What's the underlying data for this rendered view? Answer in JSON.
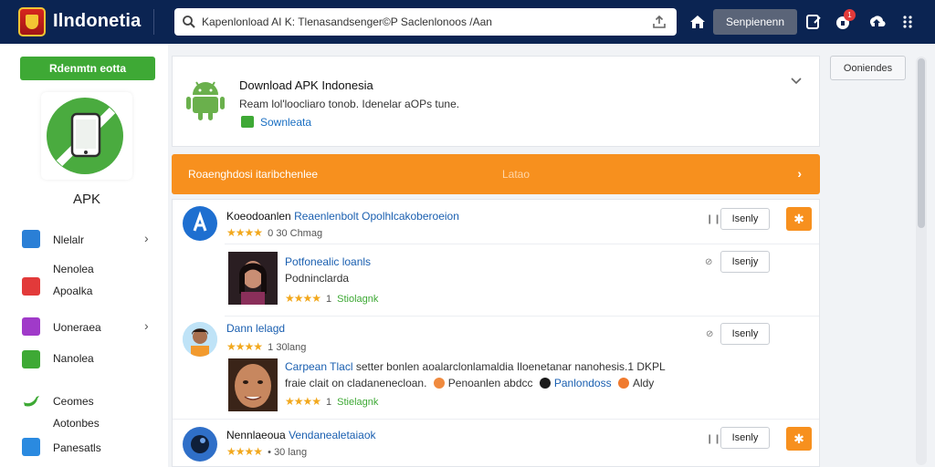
{
  "header": {
    "brand": "Ilndonetia",
    "search_text": "Kapenlonload AI K: Tlenasandsenger©P Saclenlonoos /Aan",
    "sign_in_label": "Senpienenn",
    "notification_count": "1",
    "colors": {
      "bar": "#0b2452",
      "button": "#5a6478"
    }
  },
  "sidebar": {
    "top_button": "Rdenmtn eotta",
    "app_label": "APK",
    "items": [
      {
        "label": "Nlelalr",
        "icon": "cloud-icon",
        "color": "#2a7fd6",
        "chevron": true
      },
      {
        "label": "Nenolea",
        "icon": "none",
        "color": "",
        "chevron": false
      },
      {
        "label": "Apoalka",
        "icon": "play-icon",
        "color": "#e23a3a",
        "chevron": false
      },
      {
        "label": "Uoneraea",
        "icon": "camera-icon",
        "color": "#a03ac9",
        "chevron": true
      },
      {
        "label": "Nanolea",
        "icon": "bars-icon",
        "color": "#3ea935",
        "chevron": false
      },
      {
        "label": "Ceomes",
        "icon": "bird-icon",
        "color": "#3ea935",
        "chevron": false
      },
      {
        "label": "Aotonbes",
        "icon": "none",
        "color": "",
        "chevron": false
      },
      {
        "label": "Panesatls",
        "icon": "twitter-icon",
        "color": "#2a8ae0",
        "chevron": false
      }
    ]
  },
  "header_card": {
    "title": "Download APK Indonesia",
    "subtitle": "Ream lol'loocliaro tonob. Idenelar aOPs tune.",
    "link": "Sownleata"
  },
  "orange_bar": {
    "label": "Roaenghdosi itaribchenlee",
    "ghost": "Latao"
  },
  "list": {
    "rows": [
      {
        "title_a": "Koeodoanlen",
        "title_b": "Reaenlenbolt Opolhlcakoberoeion",
        "stars": "★★★★",
        "rating_text": "0 30 Chmag",
        "get_label": "Isenly",
        "sub": {
          "title": "Potfonealic loanls",
          "line": "Podninclarda",
          "stars": "★★★★",
          "num": "1",
          "tag": "Stiolagnk",
          "get_label": "Isenjy"
        }
      },
      {
        "title_a": "",
        "title_b": "Dann lelagd",
        "stars": "★★★★",
        "rating_text": "1 30lang",
        "get_label": "Isenly",
        "sub": {
          "title": "Carpean Tlacl",
          "line_rest": "setter bonlen aoalarclonlamaldia  Iloenetanar nanohesis.1 DKPL",
          "line2_a": "fraie clait on cladanenecloan.",
          "line2_b": "Penoanlen abdcc",
          "line2_c": "Panlondoss",
          "line2_d": "Aldy",
          "stars": "★★★★",
          "num": "1",
          "tag": "Stielagnk"
        }
      },
      {
        "title_a": "Nennlaeoua",
        "title_b": "Vendanealetaiaok",
        "stars": "★★★★",
        "rating_text": "• 30 lang",
        "get_label": "Isenly"
      }
    ]
  },
  "right": {
    "button": "Ooniendes"
  }
}
